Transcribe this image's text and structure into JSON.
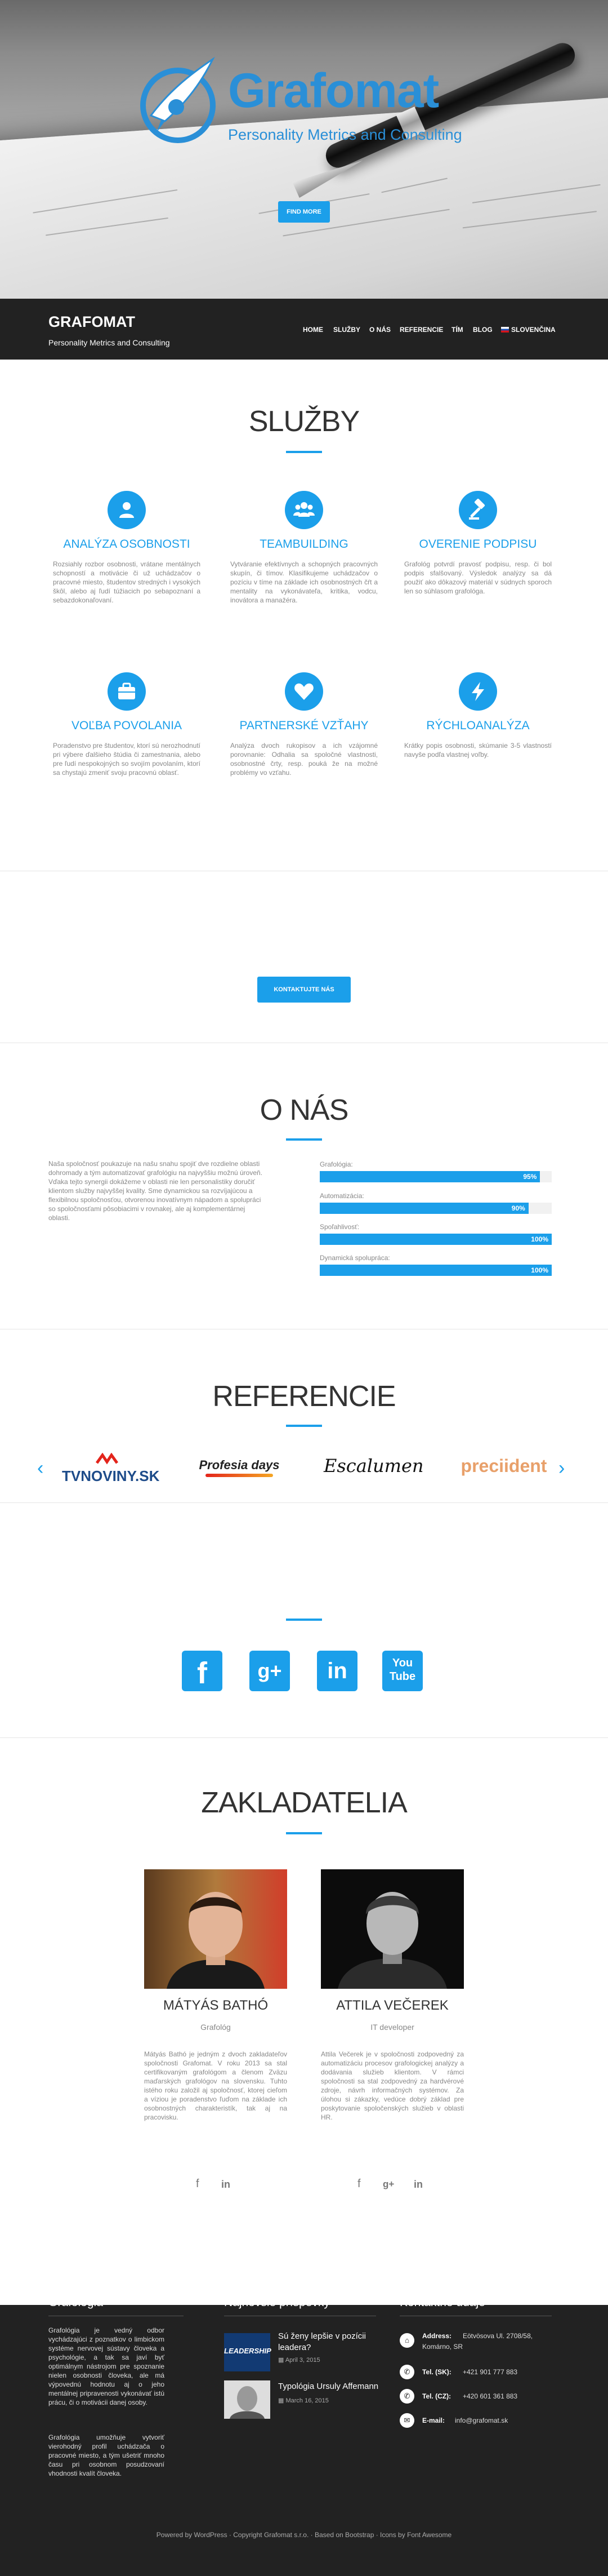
{
  "hero": {
    "logo_name": "Grafomat",
    "logo_tagline": "Personality Metrics and Consulting",
    "button_label": "FIND MORE"
  },
  "header": {
    "brand": "GRAFOMAT",
    "brand_sub": "Personality Metrics and Consulting",
    "nav": [
      "HOME",
      "SLUŽBY",
      "O NÁS",
      "REFERENCIE",
      "TÍM",
      "BLOG",
      "SLOVENČINA"
    ]
  },
  "services": {
    "title": "SLUŽBY",
    "items": [
      {
        "icon": "user-icon",
        "title": "ANALÝZA OSOBNOSTI",
        "text": "Rozsiahly rozbor osobnosti, vrátane mentálnych schopností a motivácie či už uchádzačov o pracovné miesto, študentov stredných i vysokých škôl, alebo aj ľudí túžiacich po sebapoznaní a sebazdokonaľovaní."
      },
      {
        "icon": "group-icon",
        "title": "TEAMBUILDING",
        "text": "Vytváranie efektívnych a schopných pracovných skupín, či tímov. Klasifikujeme uchádzačov o pozíciu v tíme na základe ich osobnostných čŕt a mentality na vykonávateľa, kritika, vodcu, inovátora a manažéra."
      },
      {
        "icon": "gavel-icon",
        "title": "OVERENIE PODPISU",
        "text": "Grafológ potvrdí pravosť podpisu, resp. či bol podpis sfalšovaný. Výsledok analýzy sa dá použiť ako dôkazový materiál v súdnych sporoch len so súhlasom grafológa."
      },
      {
        "icon": "briefcase-icon",
        "title": "VOĽBA POVOLANIA",
        "text": "Poradenstvo pre študentov, ktorí sú nerozhodnutí pri výbere ďalšieho štúdia či zamestnania, alebo pre ľudí nespokojných so svojím povolaním, ktorí sa chystajú zmeniť svoju pracovnú oblasť."
      },
      {
        "icon": "heart-icon",
        "title": "PARTNERSKÉ VZŤAHY",
        "text": "Analýza dvoch rukopisov a ich vzájomné porovnanie: Odhalia sa spoločné vlastnosti, osobnostné črty, resp. pouká že na možné problémy vo vzťahu."
      },
      {
        "icon": "bolt-icon",
        "title": "RÝCHLOANALÝZA",
        "text": "Krátky popis osobnosti, skúmanie 3-5 vlastností navyše podľa vlastnej voľby."
      }
    ],
    "cta": "KONTAKTUJTE NÁS"
  },
  "about": {
    "title": "O NÁS",
    "text": "Naša spoločnosť poukazuje na našu snahu spojiť dve rozdielne oblasti dohromady a tým automatizovať grafológiu na najvyššiu možnú úroveň. Vďaka tejto synergii dokážeme v oblasti nie len personalistiky doručiť klientom služby najvyššej kvality. Sme dynamickou sa rozvíjajúcou a flexibilnou spoločnosťou, otvorenou inovatívnym nápadom a spolupráci so spoločnosťami pôsobiacimi v rovnakej, ale aj komplementárnej oblasti.",
    "skills": [
      {
        "label": "Grafológia:",
        "value": 95,
        "display": "95%"
      },
      {
        "label": "Automatizácia:",
        "value": 90,
        "display": "90%"
      },
      {
        "label": "Spoľahlivosť:",
        "value": 100,
        "display": "100%"
      },
      {
        "label": "Dynamická spolupráca:",
        "value": 100,
        "display": "100%"
      }
    ]
  },
  "references": {
    "title": "REFERENCIE",
    "logos": [
      "TVNOVINY.SK",
      "Profesia days",
      "Escalumen",
      "preciident"
    ]
  },
  "social": {
    "icons": [
      "facebook-icon",
      "google-plus-icon",
      "linkedin-icon",
      "youtube-icon"
    ],
    "labels": [
      "f",
      "g+",
      "in",
      "You Tube"
    ]
  },
  "founders": {
    "title": "ZAKLADATELIA",
    "people": [
      {
        "name": "MÁTYÁS BATHÓ",
        "role": "Grafológ",
        "text": "Mátyás Bathó je jedným z dvoch zakladateľov spoločnosti Grafomat. V roku 2013 sa stal certifikovaným grafológom a členom Zväzu maďarských grafológov na slovensku. Tuhto istého roku založil aj spoločnosť, ktorej cieľom a víziou je poradenstvo ľuďom na základe ich osobnostných charakteristík, tak aj na pracovisku."
      },
      {
        "name": "ATTILA VEČEREK",
        "role": "IT developer",
        "text": "Attila Večerek je v spoločnosti zodpovedný za automatizáciu procesov grafologickej analýzy a dodávania služieb klientom. V rámci spoločnosti sa stal zodpovedný za hardvérové zdroje, návrh informačných systémov. Za úlohou si zákazky, vedúce dobrý základ pre poskytovanie spoločenských služieb v oblasti HR."
      }
    ]
  },
  "footer": {
    "col1_title": "Grafológia",
    "col1_p1": "Grafológia je vedný odbor vychádzajúci z poznatkov o limbickom systéme nervovej sústavy človeka a psychológie, a tak sa javí byť optimálnym nástrojom pre spoznanie nielen osobnosti človeka, ale má výpovednú hodnotu aj o jeho mentálnej pripravenosti vykonávať istú prácu, či o motivácii danej osoby.",
    "col1_p2": "Grafológia umožňuje vytvoriť vierohodný profil uchádzača o pracovné miesto, a tým ušetriť mnoho času pri osobnom posudzovaní vhodnosti kvalít človeka.",
    "col2_title": "Najnovšie príspevky",
    "posts": [
      {
        "thumb": "LEADERSHIP",
        "title": "Sú ženy lepšie v pozícii leadera?",
        "date": "April 3, 2015"
      },
      {
        "thumb": "",
        "title": "Typológia Ursuly Affemann",
        "date": "March 16, 2015"
      }
    ],
    "col3_title": "Kontaktné údaje",
    "contacts": [
      {
        "icon": "home-icon",
        "label": "Address:",
        "value": "Eötvösova Ul. 2708/58,",
        "value2": "Komárno, SR"
      },
      {
        "icon": "phone-icon",
        "label": "Tel. (SK):",
        "value": "+421 901 777 883"
      },
      {
        "icon": "phone-icon",
        "label": "Tel. (CZ):",
        "value": "+420 601 361 883"
      },
      {
        "icon": "mail-icon",
        "label": "E-mail:",
        "value": "info@grafomat.sk"
      }
    ],
    "bottom": "Powered by WordPress · Copyright Grafomat s.r.o. · Based on Bootstrap · Icons by Font Awesome"
  },
  "colors": {
    "accent": "#1b9fea",
    "dark": "#222222"
  }
}
